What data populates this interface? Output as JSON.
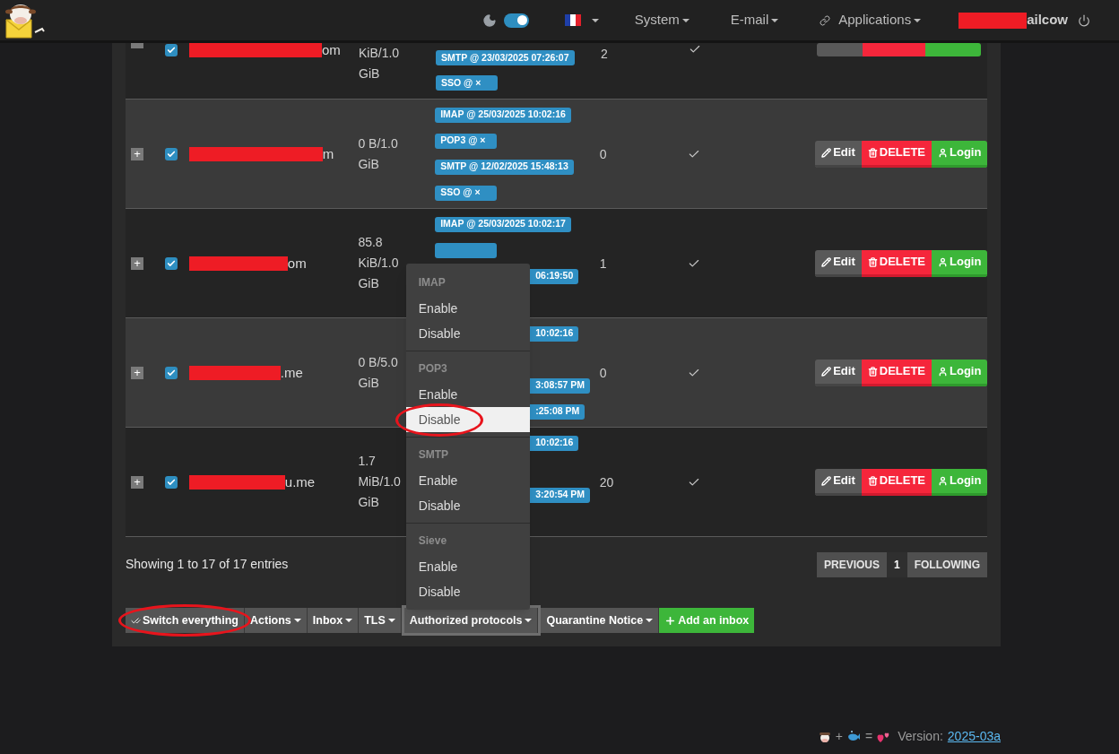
{
  "navbar": {
    "dark_mode": {
      "on": true
    },
    "menus": [
      {
        "label": "System",
        "kind": "plain"
      },
      {
        "label": "E-mail",
        "kind": "plain"
      },
      {
        "label": "Applications",
        "kind": "link"
      }
    ],
    "user": {
      "name_tail": "ailcow"
    }
  },
  "rows": [
    {
      "kind": "clipped",
      "checked": true,
      "email_tail": "om",
      "quota": [
        "KiB/1.0",
        "GiB"
      ],
      "protocols": [
        {
          "kind": "full",
          "text": "SMTP @ 23/03/2025 07:26:07"
        },
        {
          "kind": "full",
          "text": "SSO @ ×"
        }
      ],
      "count": "2",
      "active": true,
      "actions": [
        {
          "kind": "edit"
        },
        {
          "kind": "delete"
        },
        {
          "kind": "login"
        }
      ]
    },
    {
      "kind": "full",
      "expand": "+",
      "checked": true,
      "email_tail": "m",
      "quota": [
        "0 B/1.0",
        "GiB"
      ],
      "protocols": [
        {
          "kind": "full",
          "text": "IMAP @ 25/03/2025 10:02:16"
        },
        {
          "kind": "full",
          "text": "POP3 @ ×"
        },
        {
          "kind": "full",
          "text": "SMTP @ 12/02/2025 15:48:13"
        },
        {
          "kind": "full",
          "text": "SSO @ ×"
        }
      ],
      "count": "0",
      "active": true,
      "actions": [
        {
          "kind": "edit",
          "label": "Edit"
        },
        {
          "kind": "delete",
          "label": "DELETE"
        },
        {
          "kind": "login",
          "label": "Login"
        }
      ]
    },
    {
      "kind": "full",
      "expand": "+",
      "checked": true,
      "email_tail": "om",
      "quota": [
        "85.8",
        "KiB/1.0",
        "GiB"
      ],
      "protocols": [
        {
          "kind": "full",
          "text": "IMAP @ 25/03/2025 10:02:17"
        },
        {
          "kind": "covered"
        },
        {
          "kind": "partial",
          "text": "06:19:50"
        }
      ],
      "count": "1",
      "active": true,
      "actions": [
        {
          "kind": "edit",
          "label": "Edit"
        },
        {
          "kind": "delete",
          "label": "DELETE"
        },
        {
          "kind": "login",
          "label": "Login"
        }
      ]
    },
    {
      "kind": "full",
      "expand": "+",
      "checked": true,
      "email_tail": ".me",
      "quota": [
        "0 B/5.0",
        "GiB"
      ],
      "protocols": [
        {
          "kind": "partial",
          "text": "10:02:16"
        },
        {
          "kind": "partial_spaced",
          "text": "3:08:57 PM"
        },
        {
          "kind": "partial",
          "text": ":25:08 PM"
        }
      ],
      "count": "0",
      "active": true,
      "actions": [
        {
          "kind": "edit",
          "label": "Edit"
        },
        {
          "kind": "delete",
          "label": "DELETE"
        },
        {
          "kind": "login",
          "label": "Login"
        }
      ]
    },
    {
      "kind": "full",
      "expand": "+",
      "checked": true,
      "email_tail": "u.me",
      "quota": [
        "1.7",
        "MiB/1.0",
        "GiB"
      ],
      "protocols": [
        {
          "kind": "partial",
          "text": "10:02:16"
        },
        {
          "kind": "partial_spaced",
          "text": "3:20:54 PM"
        }
      ],
      "count": "20",
      "active": true,
      "actions": [
        {
          "kind": "edit",
          "label": "Edit"
        },
        {
          "kind": "delete",
          "label": "DELETE"
        },
        {
          "kind": "login",
          "label": "Login"
        }
      ]
    }
  ],
  "summary": "Showing 1 to 17 of 17 entries",
  "pagination": [
    {
      "label": "PREVIOUS",
      "selected": false
    },
    {
      "label": "1",
      "selected": true
    },
    {
      "label": "FOLLOWING",
      "selected": false
    }
  ],
  "toolbar": [
    {
      "label": "Switch everything",
      "kind": "check",
      "annotated": true,
      "expanded": false
    },
    {
      "label": "Actions",
      "kind": "dropdown",
      "annotated": false,
      "expanded": false
    },
    {
      "label": "Inbox",
      "kind": "dropdown",
      "annotated": false,
      "expanded": false
    },
    {
      "label": "TLS",
      "kind": "dropdown",
      "annotated": false,
      "expanded": false
    },
    {
      "label": "Authorized protocols",
      "kind": "dropdown",
      "annotated": false,
      "expanded": true,
      "menu": [
        {
          "header": "IMAP",
          "items": [
            {
              "label": "Enable",
              "selected": false,
              "annotated": false
            },
            {
              "label": "Disable",
              "selected": false,
              "annotated": false
            }
          ]
        },
        {
          "header": "POP3",
          "items": [
            {
              "label": "Enable",
              "selected": false,
              "annotated": false
            },
            {
              "label": "Disable",
              "selected": true,
              "annotated": true
            }
          ]
        },
        {
          "header": "SMTP",
          "items": [
            {
              "label": "Enable",
              "selected": false,
              "annotated": false
            },
            {
              "label": "Disable",
              "selected": false,
              "annotated": false
            }
          ]
        },
        {
          "header": "Sieve",
          "items": [
            {
              "label": "Enable",
              "selected": false,
              "annotated": false
            },
            {
              "label": "Disable",
              "selected": false,
              "annotated": false
            }
          ]
        }
      ]
    },
    {
      "label": "Quarantine Notice",
      "kind": "dropdown",
      "annotated": false,
      "expanded": false
    },
    {
      "label": "Add an inbox",
      "kind": "add",
      "annotated": false,
      "expanded": false
    }
  ],
  "footer": {
    "operators": [
      "+",
      "="
    ],
    "version_label": "Version:",
    "version": "2025-03a"
  }
}
